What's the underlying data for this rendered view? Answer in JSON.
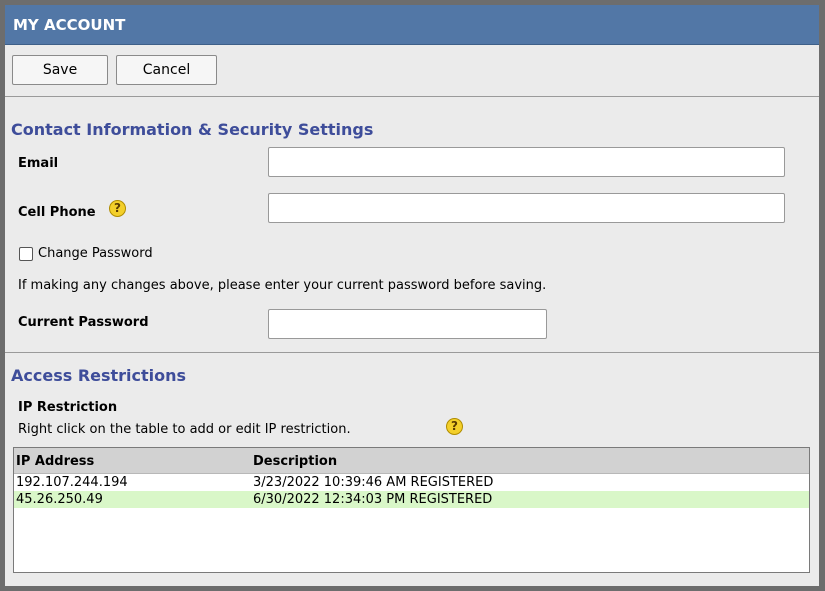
{
  "header": {
    "title": "MY ACCOUNT"
  },
  "toolbar": {
    "save_label": "Save",
    "cancel_label": "Cancel"
  },
  "contact": {
    "section_title": "Contact Information & Security Settings",
    "email_label": "Email",
    "email_value": "",
    "cell_phone_label": "Cell Phone",
    "help_glyph": "?",
    "change_password_label": "Change Password",
    "change_password_checked": false,
    "notice": "If making any changes above, please enter your current password before saving.",
    "current_password_label": "Current Password",
    "current_password_value": ""
  },
  "access": {
    "section_title": "Access Restrictions",
    "subheading": "IP Restriction",
    "hint": "Right click on the table to add or edit IP restriction.",
    "help_glyph": "?",
    "table": {
      "columns": [
        "IP Address",
        "Description"
      ],
      "rows": [
        {
          "ip": "192.107.244.194",
          "description": "3/23/2022 10:39:46 AM REGISTERED"
        },
        {
          "ip": "45.26.250.49",
          "description": "6/30/2022 12:34:03 PM REGISTERED"
        }
      ]
    }
  },
  "icons": {
    "help": "help-question-icon"
  },
  "colors": {
    "titlebar": "#5277a6",
    "section_title": "#3e4d9a",
    "row_highlight": "#d9f7c8",
    "help_icon": "#f3cf2a"
  }
}
